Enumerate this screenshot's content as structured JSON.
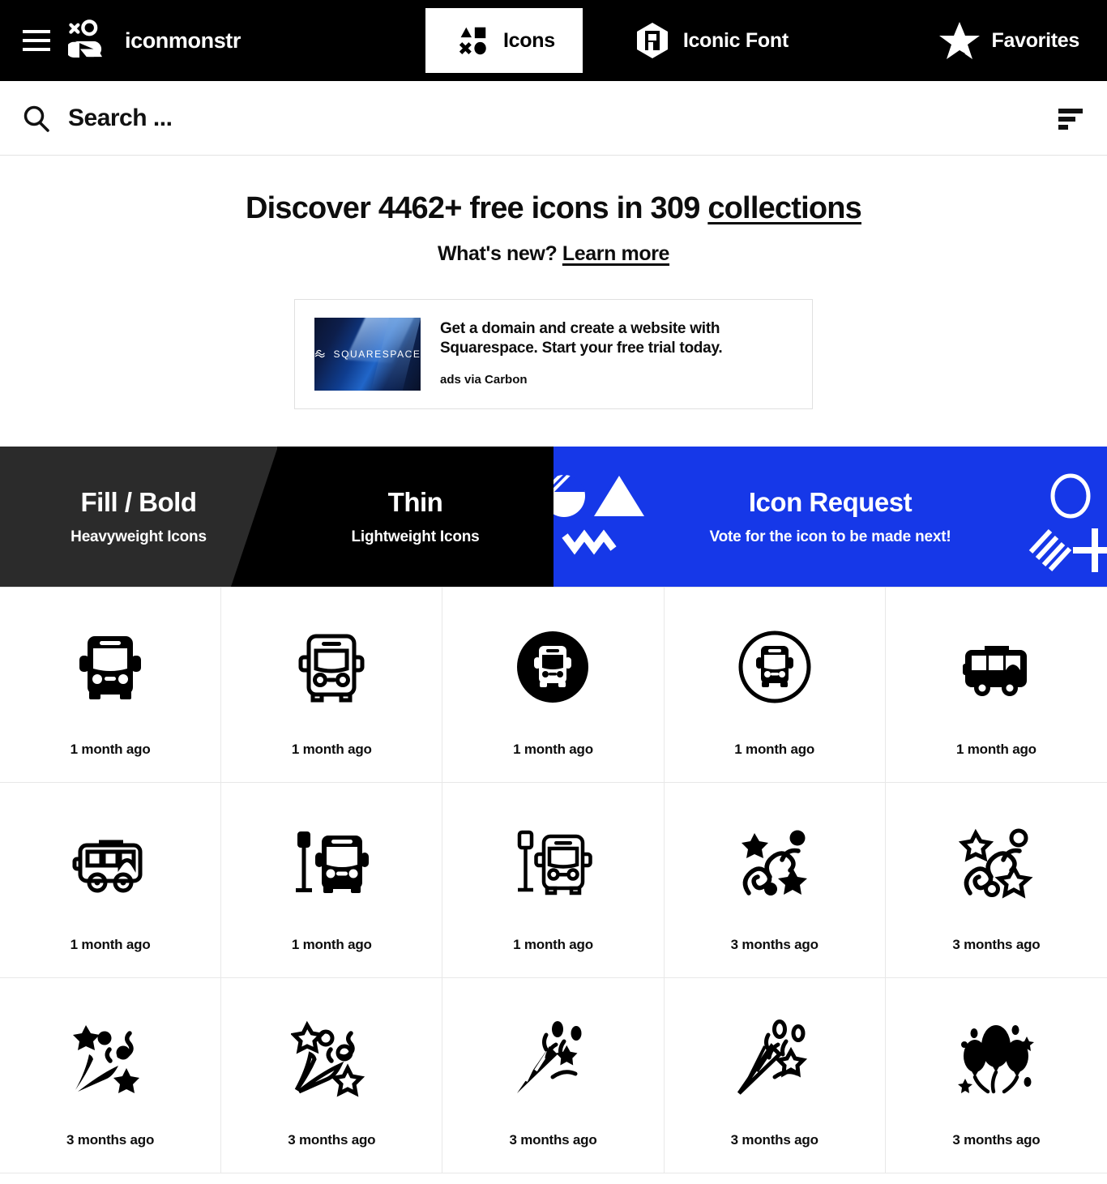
{
  "header": {
    "menu_icon": "hamburger-icon",
    "brand": {
      "logo": "iconmonstr-logo",
      "name": "iconmonstr"
    },
    "tabs": [
      {
        "id": "icons",
        "label": "Icons",
        "icon": "shapes-icon",
        "active": true
      },
      {
        "id": "iconic-font",
        "label": "Iconic Font",
        "icon": "hexagon-font-icon",
        "active": false
      }
    ],
    "favorites": {
      "label": "Favorites",
      "icon": "star-icon"
    }
  },
  "search": {
    "placeholder": "Search ...",
    "value": "",
    "icon": "search-icon",
    "sort_icon": "sort-filter-icon"
  },
  "hero": {
    "title_pre": "Discover 4462+ free icons in 309 ",
    "title_link": "collections",
    "count_icons": "4462+",
    "count_collections": "309",
    "subtitle_pre": "What's new? ",
    "subtitle_link": "Learn more"
  },
  "ad": {
    "brand": "SQUARESPACE",
    "text": "Get a domain and create a website with Squarespace. Start your free trial today.",
    "via": "ads via Carbon"
  },
  "promos": [
    {
      "id": "fill-bold",
      "title": "Fill / Bold",
      "subtitle": "Heavyweight Icons",
      "bg": "#2b2b2b"
    },
    {
      "id": "thin",
      "title": "Thin",
      "subtitle": "Lightweight Icons",
      "bg": "#000000"
    },
    {
      "id": "icon-request",
      "title": "Icon Request",
      "subtitle": "Vote for the icon to be made next!",
      "bg": "#1638e8"
    }
  ],
  "grid": {
    "items": [
      {
        "icon": "bus-front-filled-icon",
        "label": "1 month ago"
      },
      {
        "icon": "bus-front-outline-icon",
        "label": "1 month ago"
      },
      {
        "icon": "bus-circle-filled-icon",
        "label": "1 month ago"
      },
      {
        "icon": "bus-circle-outline-icon",
        "label": "1 month ago"
      },
      {
        "icon": "bus-side-filled-icon",
        "label": "1 month ago"
      },
      {
        "icon": "bus-side-outline-icon",
        "label": "1 month ago"
      },
      {
        "icon": "bus-stop-filled-icon",
        "label": "1 month ago"
      },
      {
        "icon": "bus-stop-outline-icon",
        "label": "1 month ago"
      },
      {
        "icon": "confetti-streamers-filled-icon",
        "label": "3 months ago"
      },
      {
        "icon": "confetti-streamers-outline-icon",
        "label": "3 months ago"
      },
      {
        "icon": "celebration-firework-filled-icon",
        "label": "3 months ago"
      },
      {
        "icon": "celebration-firework-outline-icon",
        "label": "3 months ago"
      },
      {
        "icon": "party-popper-filled-icon",
        "label": "3 months ago"
      },
      {
        "icon": "party-popper-outline-icon",
        "label": "3 months ago"
      },
      {
        "icon": "balloons-filled-icon",
        "label": "3 months ago"
      }
    ]
  },
  "colors": {
    "accent_blue": "#1638e8",
    "panel_dark": "#2b2b2b",
    "panel_black": "#000000",
    "text": "#0d0d0d",
    "divider": "#e8e8e8"
  }
}
